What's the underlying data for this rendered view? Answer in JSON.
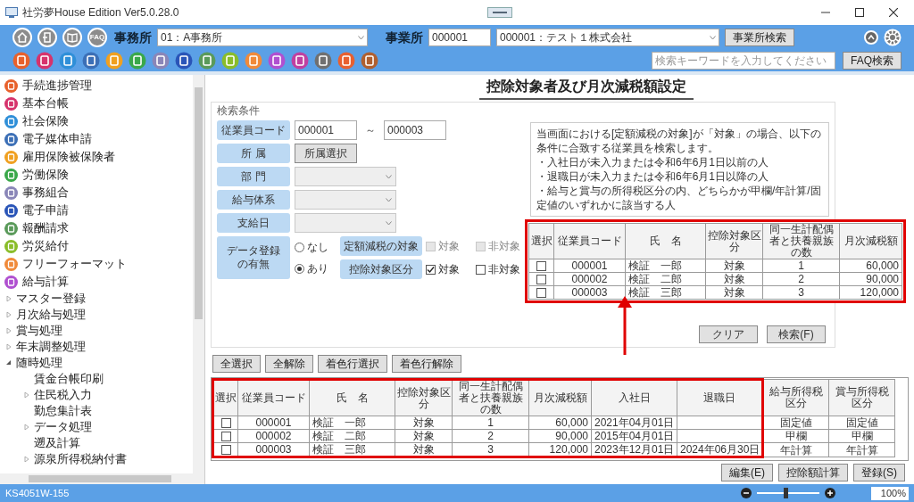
{
  "window": {
    "title": "社労夢House Edition Ver5.0.28.0"
  },
  "toolbar": {
    "nav_buttons": [
      {
        "kind": "home"
      },
      {
        "kind": "back"
      },
      {
        "kind": "book"
      },
      {
        "kind": "faq",
        "label": "FAQ"
      }
    ],
    "office_label": "事務所",
    "office_select": "01：A事務所",
    "site_label": "事業所",
    "site_code": "000001",
    "site_select": "000001：テスト１株式会社",
    "site_search_button": "事業所検索",
    "app_icons": [
      {
        "color": "#e8612c"
      },
      {
        "color": "#d6336c"
      },
      {
        "color": "#2f8fd8"
      },
      {
        "color": "#3b6fb6"
      },
      {
        "color": "#f0a020"
      },
      {
        "color": "#3aa84a"
      },
      {
        "color": "#8a86b8"
      },
      {
        "color": "#2a55b8"
      },
      {
        "color": "#5a9a5a"
      },
      {
        "color": "#8abd2a"
      },
      {
        "color": "#f08a3a"
      },
      {
        "color": "#b050d0"
      },
      {
        "color": "#c040a0"
      },
      {
        "color": "#707070"
      },
      {
        "color": "#e86030"
      },
      {
        "color": "#b06030"
      }
    ],
    "keyword_search": {
      "placeholder": "検索キーワードを入力してください"
    },
    "faq_search_button": "FAQ検索"
  },
  "sidebar": {
    "items": [
      {
        "label": "手続進捗管理",
        "color": "#e8612c"
      },
      {
        "label": "基本台帳",
        "color": "#d6336c"
      },
      {
        "label": "社会保険",
        "color": "#2f8fd8"
      },
      {
        "label": "電子媒体申請",
        "color": "#3b6fb6"
      },
      {
        "label": "雇用保険被保険者",
        "color": "#f0a020"
      },
      {
        "label": "労働保険",
        "color": "#3aa84a"
      },
      {
        "label": "事務組合",
        "color": "#8a86b8"
      },
      {
        "label": "電子申請",
        "color": "#2a55b8"
      },
      {
        "label": "報酬請求",
        "color": "#5a9a5a"
      },
      {
        "label": "労災給付",
        "color": "#8abd2a"
      },
      {
        "label": "フリーフォーマット",
        "color": "#f08a3a"
      },
      {
        "label": "給与計算",
        "color": "#b050d0"
      }
    ],
    "tree": [
      {
        "label": "マスター登録",
        "expanded": false
      },
      {
        "label": "月次給与処理",
        "expanded": false
      },
      {
        "label": "賞与処理",
        "expanded": false
      },
      {
        "label": "年末調整処理",
        "expanded": false
      },
      {
        "label": "随時処理",
        "expanded": true,
        "children": [
          {
            "label": "賃金台帳印刷"
          },
          {
            "label": "住民税入力",
            "expanded": false
          },
          {
            "label": "勤怠集計表"
          },
          {
            "label": "データ処理",
            "expanded": false
          },
          {
            "label": "遡及計算"
          },
          {
            "label": "源泉所得税納付書",
            "expanded": false
          }
        ]
      }
    ]
  },
  "screen_title": "控除対象者及び月次減税額設定",
  "search": {
    "legend": "検索条件",
    "employee_code": {
      "label": "従業員コード",
      "from": "000001",
      "separator": "～",
      "to": "000003"
    },
    "affiliation": {
      "label": "所 属",
      "button": "所属選択"
    },
    "dropdowns": [
      {
        "label": "部 門"
      },
      {
        "label": "給与体系"
      },
      {
        "label": "支給日"
      }
    ],
    "data_registration": {
      "label_lines": [
        "データ登録",
        "の有無"
      ],
      "options": [
        {
          "label": "なし",
          "selected": false
        },
        {
          "label": "あり",
          "selected": true
        }
      ]
    },
    "flag_rows": [
      {
        "label": "定額減税の対象",
        "options": [
          {
            "label": "対象",
            "checked": false,
            "disabled": true
          },
          {
            "label": "非対象",
            "checked": false,
            "disabled": true
          }
        ]
      },
      {
        "label": "控除対象区分",
        "options": [
          {
            "label": "対象",
            "checked": true,
            "disabled": false
          },
          {
            "label": "非対象",
            "checked": false,
            "disabled": false
          }
        ]
      }
    ],
    "note": [
      "当画面における[定額減税の対象]が「対象」の場合、以下の条件に合致する従業員を検索します。",
      "・入社日が未入力または令和6年6月1日以前の人",
      "・退職日が未入力または令和6年6月1日以降の人",
      "・給与と賞与の所得税区分の内、どちらかが甲欄/年計算/固定値のいずれかに該当する人"
    ],
    "buttons": [
      "クリア",
      "検索(F)"
    ]
  },
  "callout": {
    "select_column": "選択",
    "columns": [
      "従業員コード",
      "氏　名",
      "控除対象区分",
      "同一生計配偶者と扶養親族の数",
      "月次減税額"
    ],
    "rows": [
      {
        "selected": false,
        "cells": [
          "000001",
          "検証　一郎",
          "対象",
          "1",
          "60,000"
        ]
      },
      {
        "selected": false,
        "cells": [
          "000002",
          "検証　二郎",
          "対象",
          "2",
          "90,000"
        ]
      },
      {
        "selected": false,
        "cells": [
          "000003",
          "検証　三郎",
          "対象",
          "3",
          "120,000"
        ]
      }
    ]
  },
  "selection_buttons": [
    "全選択",
    "全解除",
    "着色行選択",
    "着色行解除"
  ],
  "table": {
    "select_column": "選択",
    "columns": [
      "従業員コード",
      "氏　名",
      "控除対象区分",
      "同一生計配偶者と扶養親族の数",
      "月次減税額",
      "入社日",
      "退職日",
      "給与所得税区分",
      "賞与所得税区分"
    ],
    "rows": [
      {
        "selected": false,
        "cells": [
          "000001",
          "検証　一郎",
          "対象",
          "1",
          "60,000",
          "2021年04月01日",
          "",
          "固定値",
          "固定値"
        ]
      },
      {
        "selected": false,
        "cells": [
          "000002",
          "検証　二郎",
          "対象",
          "2",
          "90,000",
          "2015年04月01日",
          "",
          "甲欄",
          "甲欄"
        ]
      },
      {
        "selected": false,
        "cells": [
          "000003",
          "検証　三郎",
          "対象",
          "3",
          "120,000",
          "2023年12月01日",
          "2024年06月30日",
          "年計算",
          "年計算"
        ]
      }
    ]
  },
  "footer_buttons": [
    "編集(E)",
    "控除額計算",
    "登録(S)"
  ],
  "status_bar": {
    "screen_id": "KS4051W-155",
    "zoom_slider": {
      "level": 0.45
    },
    "zoom": "100%"
  }
}
